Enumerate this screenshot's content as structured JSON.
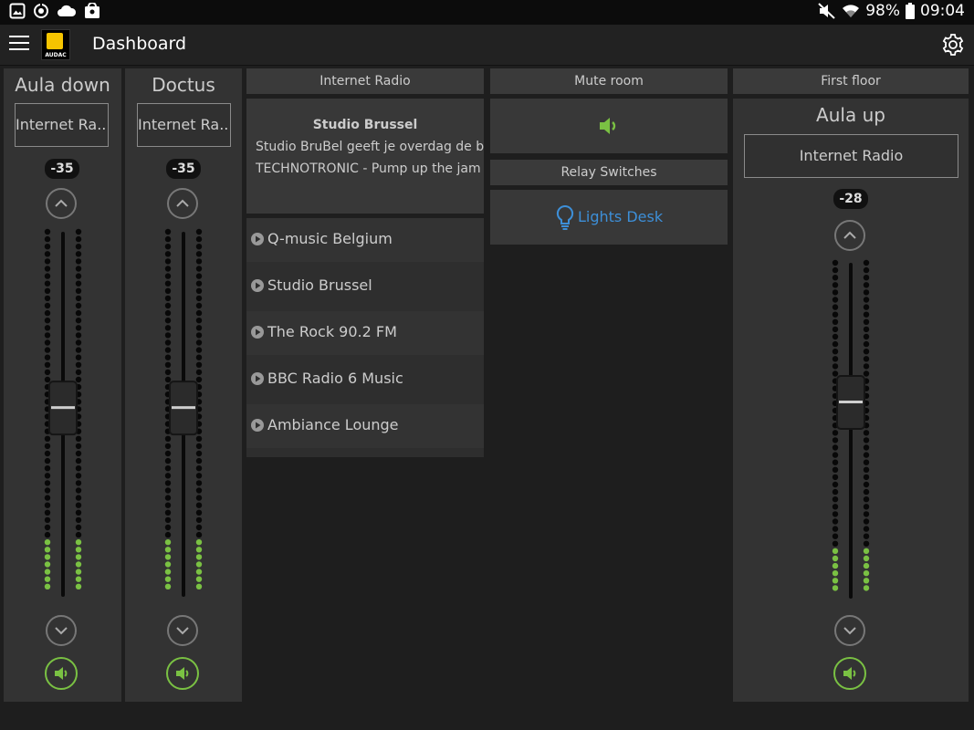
{
  "status_bar": {
    "battery": "98%",
    "time": "09:04"
  },
  "app_bar": {
    "title": "Dashboard",
    "logo_text": "AUDAC"
  },
  "zones": [
    {
      "name": "Aula down",
      "source": "Internet Ra...",
      "volume": "-35",
      "level": 0.52
    },
    {
      "name": "Doctus",
      "source": "Internet Ra...",
      "volume": "-35",
      "level": 0.52
    },
    {
      "group": "First floor",
      "name": "Aula up",
      "source": "Internet Radio",
      "volume": "-28",
      "level": 0.6
    }
  ],
  "internet_radio": {
    "header": "Internet Radio",
    "station": "Studio Brussel",
    "line1": "Studio BruBel geeft je overdag de b...",
    "line2": "TECHNOTRONIC - Pump up the jam",
    "stations": [
      "Q-music Belgium",
      "Studio Brussel",
      "The Rock 90.2 FM",
      "BBC Radio 6 Music",
      "Ambiance Lounge"
    ]
  },
  "mute_room": {
    "header": "Mute room"
  },
  "relay_switches": {
    "header": "Relay Switches",
    "relay": "Lights Desk"
  },
  "colors": {
    "accent_green": "#7ac143",
    "accent_blue": "#3d8fd8",
    "panel": "#333333"
  }
}
